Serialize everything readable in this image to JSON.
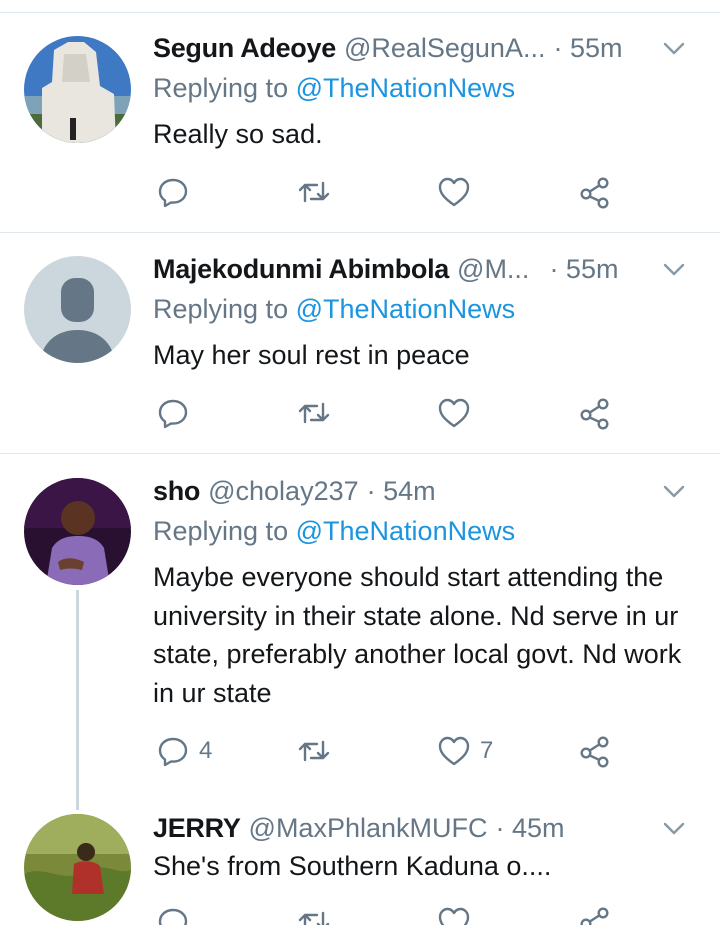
{
  "colors": {
    "accent": "#1b95e0",
    "muted": "#657786",
    "text": "#14171a",
    "divider": "#e1e8ed"
  },
  "tweets": [
    {
      "name": "Segun Adeoye",
      "handle": "@RealSegunA...",
      "time": "· 55m",
      "reply_prefix": "Replying to",
      "reply_to": "@TheNationNews",
      "text": "Really so sad.",
      "reply_count": "",
      "retweet_count": "",
      "like_count": ""
    },
    {
      "name": "Majekodunmi Abimbola",
      "handle": "@M...",
      "time": "· 55m",
      "reply_prefix": "Replying to",
      "reply_to": "@TheNationNews",
      "text": "May her soul rest in peace",
      "reply_count": "",
      "retweet_count": "",
      "like_count": ""
    },
    {
      "name": "sho",
      "handle": "@cholay237",
      "time": "· 54m",
      "reply_prefix": "Replying to",
      "reply_to": "@TheNationNews",
      "text": "Maybe everyone should start attending the university in their state alone. Nd serve in ur state, preferably another local govt. Nd work in ur state",
      "reply_count": "4",
      "retweet_count": "",
      "like_count": "7"
    },
    {
      "name": "JERRY",
      "handle": "@MaxPhlankMUFC",
      "time": "· 45m",
      "text": "She's from Southern Kaduna o...."
    }
  ]
}
